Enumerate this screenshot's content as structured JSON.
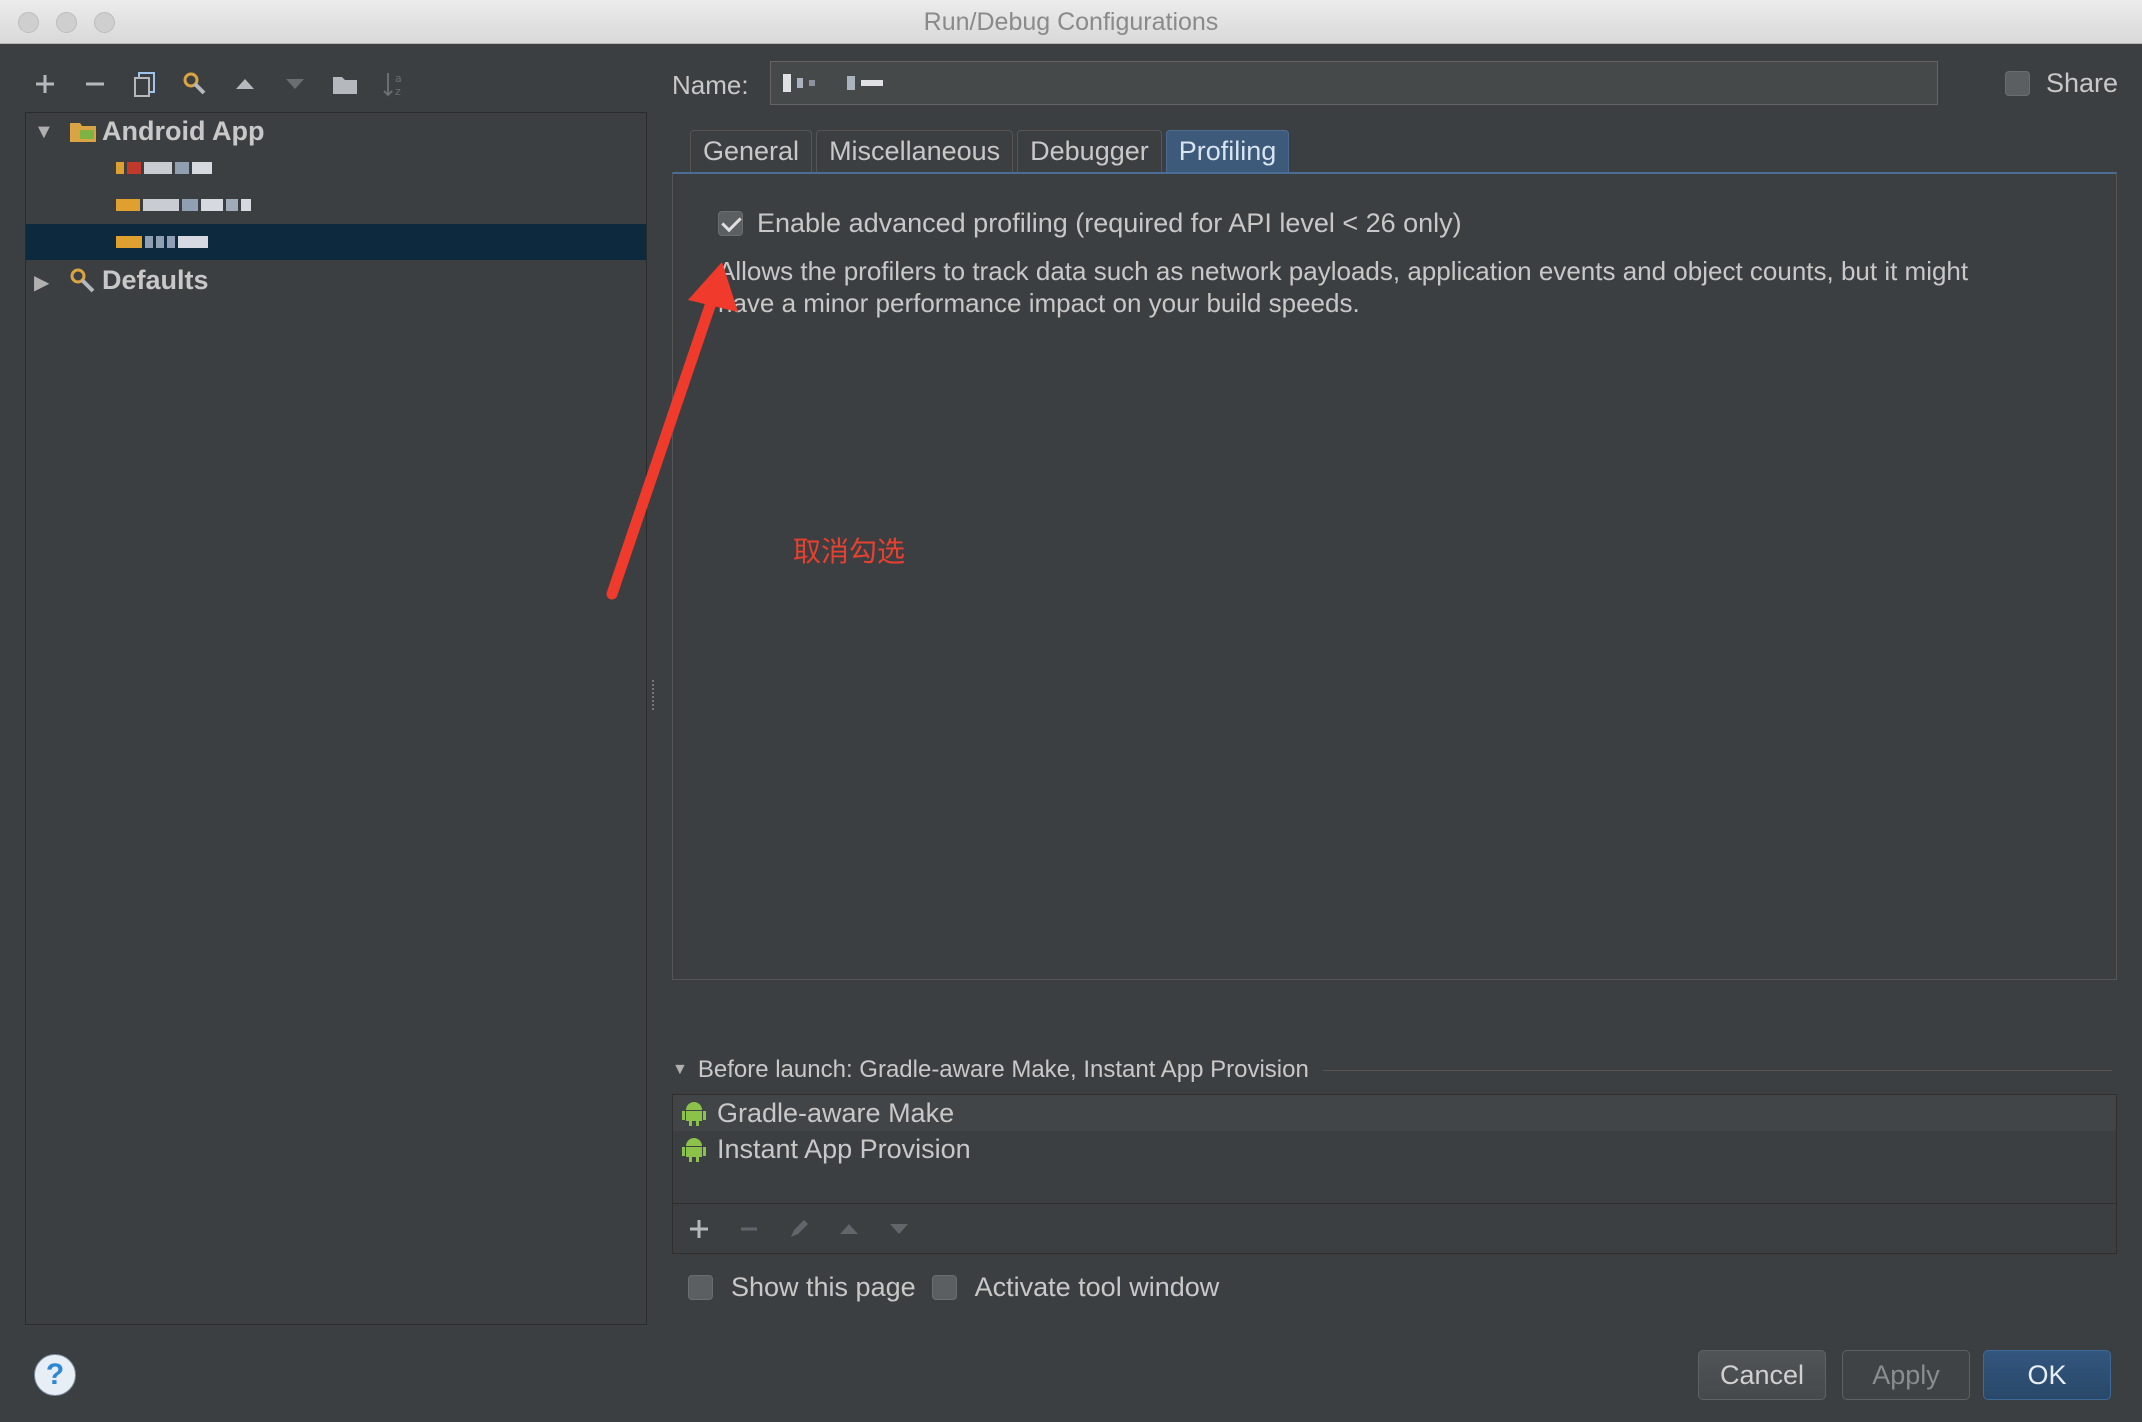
{
  "window": {
    "title": "Run/Debug Configurations"
  },
  "toolbar": {
    "items": [
      "add-icon",
      "remove-icon",
      "copy-icon",
      "edit-defaults-icon",
      "move-up-icon",
      "move-down-icon",
      "folder-icon",
      "sort-icon"
    ]
  },
  "tree": {
    "root_label": "Android App",
    "defaults_label": "Defaults"
  },
  "form": {
    "name_label": "Name:",
    "share_label": "Share"
  },
  "tabs": [
    {
      "label": "General"
    },
    {
      "label": "Miscellaneous"
    },
    {
      "label": "Debugger"
    },
    {
      "label": "Profiling",
      "active": true
    }
  ],
  "profiling": {
    "enable_label": "Enable advanced profiling (required for API level < 26 only)",
    "enable_checked": true,
    "description": "Allows the profilers to track data such as network payloads, application events and object counts, but it might have a minor performance impact on your build speeds."
  },
  "annotation": {
    "text": "取消勾选",
    "color": "#e8402f"
  },
  "before_launch": {
    "header": "Before launch: Gradle-aware Make, Instant App Provision",
    "items": [
      "Gradle-aware Make",
      "Instant App Provision"
    ]
  },
  "options": {
    "show_page": "Show this page",
    "activate_tool": "Activate tool window"
  },
  "buttons": {
    "help": "?",
    "cancel": "Cancel",
    "apply": "Apply",
    "ok": "OK"
  },
  "colors": {
    "accent": "#4b6d93",
    "selection": "#0d293e",
    "android_green": "#8bc34a"
  }
}
